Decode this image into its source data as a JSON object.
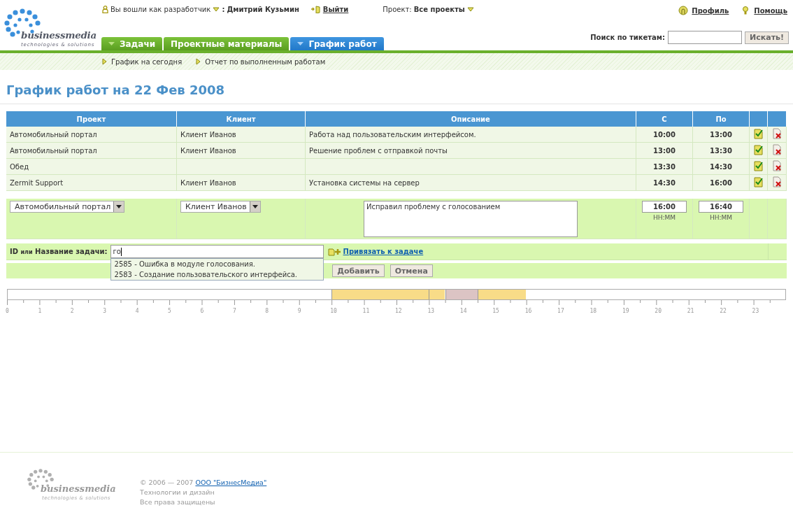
{
  "header": {
    "logo": {
      "name": "businessmedia",
      "tagline": "technologies & solutions"
    },
    "user": {
      "prefix": "Вы вошли как разработчик",
      "separator": ":",
      "name": "Дмитрий Кузьмин",
      "logout": "Выйти"
    },
    "project": {
      "label": "Проект:",
      "value": "Все проекты"
    },
    "links": [
      "Профиль",
      "Помощь"
    ],
    "search": {
      "label": "Поиск по тикетам:",
      "button": "Искать!"
    },
    "tabs": [
      {
        "label": "Задачи",
        "selected": false,
        "arrow": true
      },
      {
        "label": "Проектные материалы",
        "selected": false,
        "arrow": false
      },
      {
        "label": "График работ",
        "selected": true,
        "arrow": true
      }
    ],
    "subnav": [
      "График на сегодня",
      "Отчет по выполненным работам"
    ]
  },
  "title": "График работ на 22 Фев 2008",
  "table": {
    "columns": [
      "Проект",
      "Клиент",
      "Описание",
      "С",
      "По"
    ],
    "rows": [
      {
        "project": "Автомобильный портал",
        "client": "Клиент Иванов",
        "description": "Работа над пользовательским интерфейсом.",
        "from": "10:00",
        "to": "13:00"
      },
      {
        "project": "Автомобильный портал",
        "client": "Клиент Иванов",
        "description": "Решение проблем с отправкой почты",
        "from": "13:00",
        "to": "13:30"
      },
      {
        "project": "Обед",
        "client": "",
        "description": "",
        "from": "13:30",
        "to": "14:30"
      },
      {
        "project": "Zermit Support",
        "client": "Клиент Иванов",
        "description": "Установка системы на сервер",
        "from": "14:30",
        "to": "16:00"
      }
    ]
  },
  "form": {
    "project": "Автомобильный портал",
    "client": "Клиент Иванов",
    "description": "Исправил проблему с голосованием",
    "from": "16:00",
    "to": "16:40",
    "from_hint": "HH:MM",
    "to_hint": "HH:MM",
    "task_label_id": "ID",
    "task_label_or": "или",
    "task_label_name": "Название задачи:",
    "task_value": "го",
    "bind_link": "Привязать к задаче",
    "suggestions": [
      "2585 - Ошибка в модуле голосования.",
      "2583 - Создание пользовательского интерфейса."
    ],
    "buttons": [
      "Добавить",
      "Отмена"
    ]
  },
  "timeline": {
    "segments": [
      {
        "kind": "work"
      },
      {
        "kind": "work"
      },
      {
        "kind": "break"
      },
      {
        "kind": "work"
      }
    ],
    "hours": [
      "0",
      "1",
      "2",
      "3",
      "4",
      "5",
      "6",
      "7",
      "8",
      "9",
      "10",
      "11",
      "12",
      "13",
      "14",
      "15",
      "16",
      "17",
      "18",
      "19",
      "20",
      "21",
      "22",
      "23"
    ]
  },
  "footer": {
    "logo": {
      "name": "businessmedia",
      "tagline": "technologies & solutions"
    },
    "copyright": "© 2006 — 2007",
    "company": "ООО \"БизнесМедиа\"",
    "lines": [
      "Технологии и дизайн",
      "Все права защищены"
    ]
  }
}
